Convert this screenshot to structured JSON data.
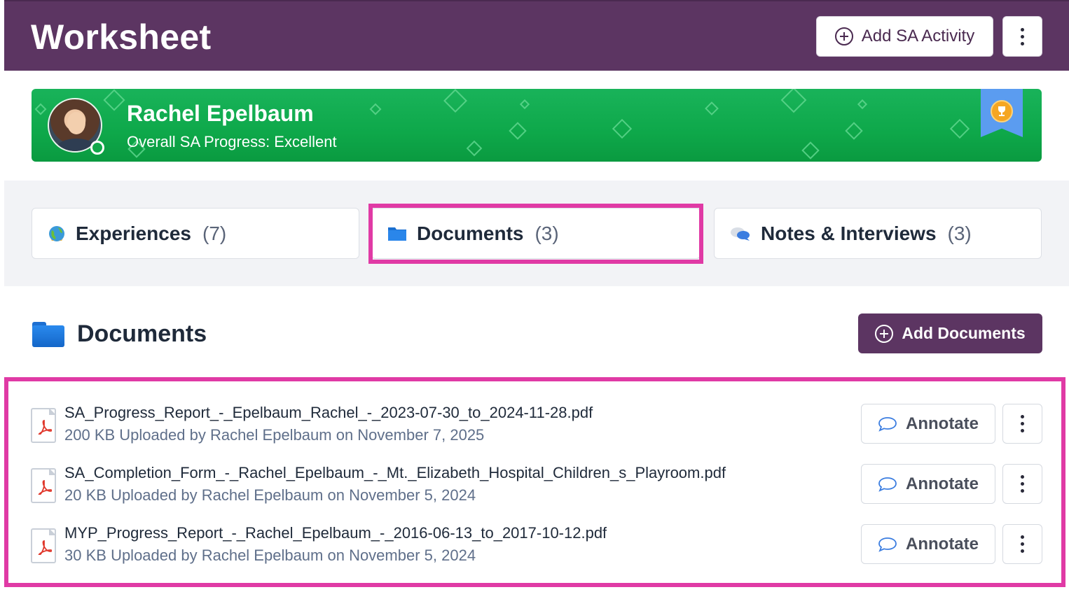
{
  "header": {
    "title": "Worksheet",
    "add_activity_label": "Add SA Activity",
    "plus_icon": "plus-circle-icon",
    "more_icon": "kebab-icon",
    "background": "#5c3562"
  },
  "student": {
    "name": "Rachel Epelbaum",
    "progress": "Overall SA Progress: Excellent",
    "status": "online",
    "award_icon": "trophy-icon",
    "banner_color": "#13ad52"
  },
  "tabs": [
    {
      "label": "Experiences",
      "count": "(7)",
      "icon": "globe-icon"
    },
    {
      "label": "Documents",
      "count": "(3)",
      "icon": "folder-icon",
      "selected": true
    },
    {
      "label": "Notes & Interviews",
      "count": "(3)",
      "icon": "speech-bubbles-icon"
    }
  ],
  "documents_section": {
    "title": "Documents",
    "add_label": "Add Documents",
    "items": [
      {
        "name": "SA_Progress_Report_-_Epelbaum_Rachel_-_2023-07-30_to_2024-11-28.pdf",
        "size": "200 KB",
        "uploaded": "Uploaded by Rachel Epelbaum on November 7, 2025",
        "action": "Annotate"
      },
      {
        "name": "SA_Completion_Form_-_Rachel_Epelbaum_-_Mt._Elizabeth_Hospital_Children_s_Playroom.pdf",
        "size": "20 KB",
        "uploaded": "Uploaded by Rachel Epelbaum on November 5, 2024",
        "action": "Annotate"
      },
      {
        "name": "MYP_Progress_Report_-_Rachel_Epelbaum_-_2016-06-13_to_2017-10-12.pdf",
        "size": "30 KB",
        "uploaded": "Uploaded by Rachel Epelbaum on November 5, 2024",
        "action": "Annotate"
      }
    ]
  },
  "colors": {
    "accent": "#5c3562",
    "highlight": "#e03aa5",
    "link_meta": "#5f6f8a"
  }
}
